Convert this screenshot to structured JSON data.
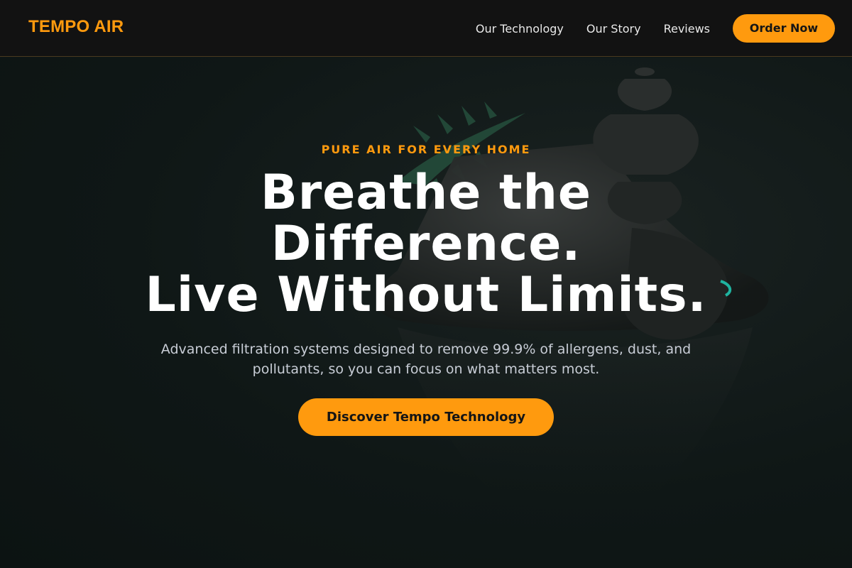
{
  "header": {
    "brand": "TEMPO AIR",
    "nav": [
      {
        "label": "Our Technology"
      },
      {
        "label": "Our Story"
      },
      {
        "label": "Reviews"
      }
    ],
    "order_label": "Order Now"
  },
  "hero": {
    "eyebrow": "PURE AIR FOR EVERY HOME",
    "headline_line1": "Breathe the",
    "headline_line2": "Difference.",
    "headline_line3": "Live Without Limits.",
    "subtext": "Advanced filtration systems designed to remove 99.9% of allergens, dust, and pollutants, so you can focus on what matters most.",
    "cta_label": "Discover Tempo Technology"
  },
  "colors": {
    "accent": "#ff9a0e",
    "background": "#0f1716",
    "nav_background": "#121212",
    "text_primary": "#ffffff",
    "text_secondary": "#c8cdd6"
  }
}
